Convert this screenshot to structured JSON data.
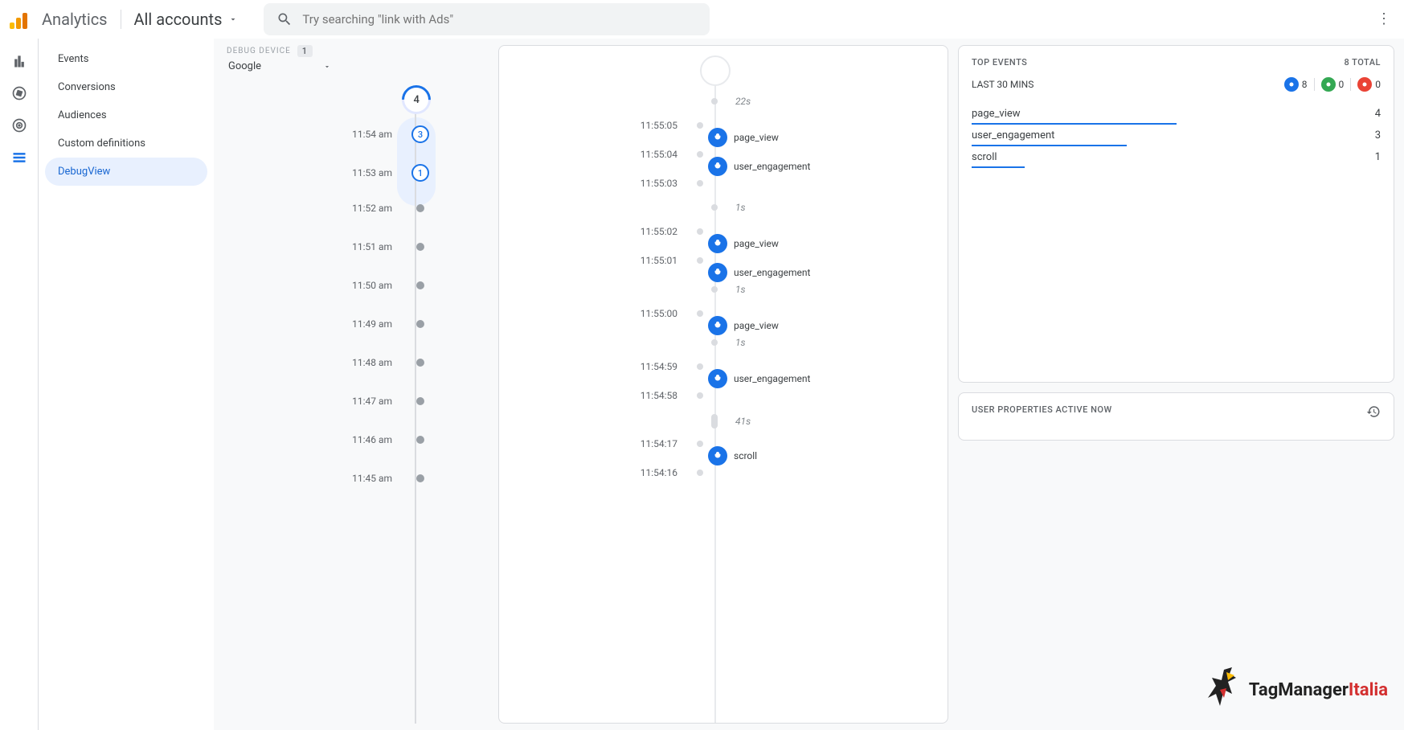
{
  "header": {
    "brand": "Analytics",
    "account": "All accounts",
    "search_placeholder": "Try searching \"link with Ads\""
  },
  "sidebar": {
    "items": [
      {
        "label": "Events"
      },
      {
        "label": "Conversions"
      },
      {
        "label": "Audiences"
      },
      {
        "label": "Custom definitions"
      },
      {
        "label": "DebugView"
      }
    ]
  },
  "debug": {
    "label": "DEBUG DEVICE",
    "count": "1",
    "device": "Google"
  },
  "minuteHead": "4",
  "minutes": [
    {
      "time": "11:54 am",
      "count": "3"
    },
    {
      "time": "11:53 am",
      "count": "1"
    },
    {
      "time": "11:52 am"
    },
    {
      "time": "11:51 am"
    },
    {
      "time": "11:50 am"
    },
    {
      "time": "11:49 am"
    },
    {
      "time": "11:48 am"
    },
    {
      "time": "11:47 am"
    },
    {
      "time": "11:46 am"
    },
    {
      "time": "11:45 am"
    }
  ],
  "seconds": [
    {
      "gap": "22s"
    },
    {
      "time": "11:55:05"
    },
    {
      "event": "page_view"
    },
    {
      "time": "11:55:04"
    },
    {
      "event": "user_engagement"
    },
    {
      "time": "11:55:03"
    },
    {
      "gap": "1s"
    },
    {
      "time": "11:55:02"
    },
    {
      "event": "page_view"
    },
    {
      "time": "11:55:01"
    },
    {
      "event": "user_engagement"
    },
    {
      "gap": "1s"
    },
    {
      "time": "11:55:00"
    },
    {
      "event": "page_view"
    },
    {
      "gap": "1s"
    },
    {
      "time": "11:54:59"
    },
    {
      "event": "user_engagement"
    },
    {
      "time": "11:54:58"
    },
    {
      "gap": "41s",
      "long": true
    },
    {
      "time": "11:54:17"
    },
    {
      "event": "scroll"
    },
    {
      "time": "11:54:16"
    }
  ],
  "topEvents": {
    "title": "TOP EVENTS",
    "total_label": "8 TOTAL",
    "range": "LAST 30 MINS",
    "chips": [
      {
        "count": "8",
        "color": "#1a73e8"
      },
      {
        "count": "0",
        "color": "#34a853"
      },
      {
        "count": "0",
        "color": "#ea4335"
      }
    ],
    "rows": [
      {
        "name": "page_view",
        "count": "4",
        "pct": 50
      },
      {
        "name": "user_engagement",
        "count": "3",
        "pct": 38
      },
      {
        "name": "scroll",
        "count": "1",
        "pct": 13
      }
    ]
  },
  "userProps": {
    "title": "USER PROPERTIES ACTIVE NOW"
  },
  "watermark": {
    "a": "TagManager",
    "b": "Italia"
  }
}
